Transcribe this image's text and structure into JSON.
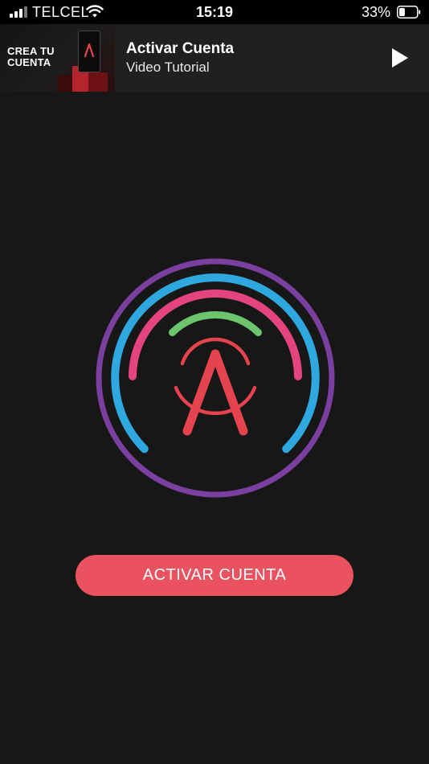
{
  "status_bar": {
    "carrier": "TELCEL",
    "time": "15:19",
    "battery_percent": "33%",
    "battery_level": 0.33,
    "signal_bars_active": 3,
    "icons": [
      "signal-icon",
      "wifi-icon",
      "battery-icon"
    ]
  },
  "tutorial_banner": {
    "thumbnail_text": "CREA TU\nCUENTA",
    "title": "Activar Cuenta",
    "subtitle": "Video Tutorial",
    "play_icon": "play-icon"
  },
  "logo": {
    "letter": "A",
    "ring_colors": {
      "outer": "#7b3fa0",
      "blue": "#2fa8e0",
      "pink": "#e4457f",
      "green": "#6cc56c",
      "emblem": "#e5434d"
    }
  },
  "main": {
    "activate_button_label": "ACTIVAR CUENTA"
  },
  "colors": {
    "background": "#171717",
    "button": "#e9525e",
    "banner": "#202020"
  }
}
